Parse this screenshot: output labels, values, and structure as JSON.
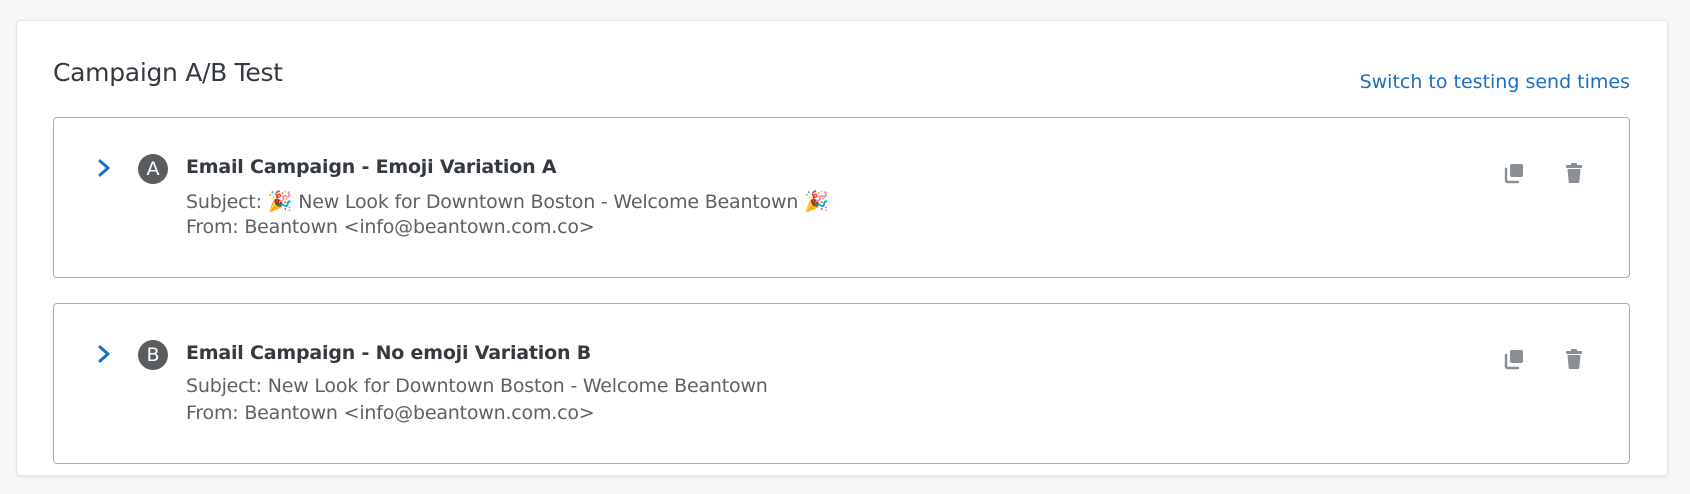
{
  "header": {
    "title": "Campaign A/B Test",
    "switch_link": "Switch to testing send times"
  },
  "variants": [
    {
      "badge": "A",
      "title": "Email Campaign - Emoji Variation A",
      "subject_label": "Subject:",
      "subject_emoji_lead": "🎉",
      "subject_text": "New Look for Downtown Boston - Welcome Beantown",
      "subject_emoji_trail": "🎉",
      "from": "From: Beantown <info@beantown.com.co>"
    },
    {
      "badge": "B",
      "title": "Email Campaign - No emoji Variation B",
      "subject_label": "Subject:",
      "subject_text": "New Look for Downtown Boston - Welcome Beantown",
      "from": "From: Beantown <info@beantown.com.co>"
    }
  ],
  "icons": {
    "expand": "chevron-right-icon",
    "duplicate": "copy-icon",
    "delete": "trash-icon"
  },
  "colors": {
    "link": "#1a6fc4",
    "chevron": "#1a6fc4",
    "badge_bg": "#5a5d60",
    "icon_gray": "#8a8f95"
  }
}
